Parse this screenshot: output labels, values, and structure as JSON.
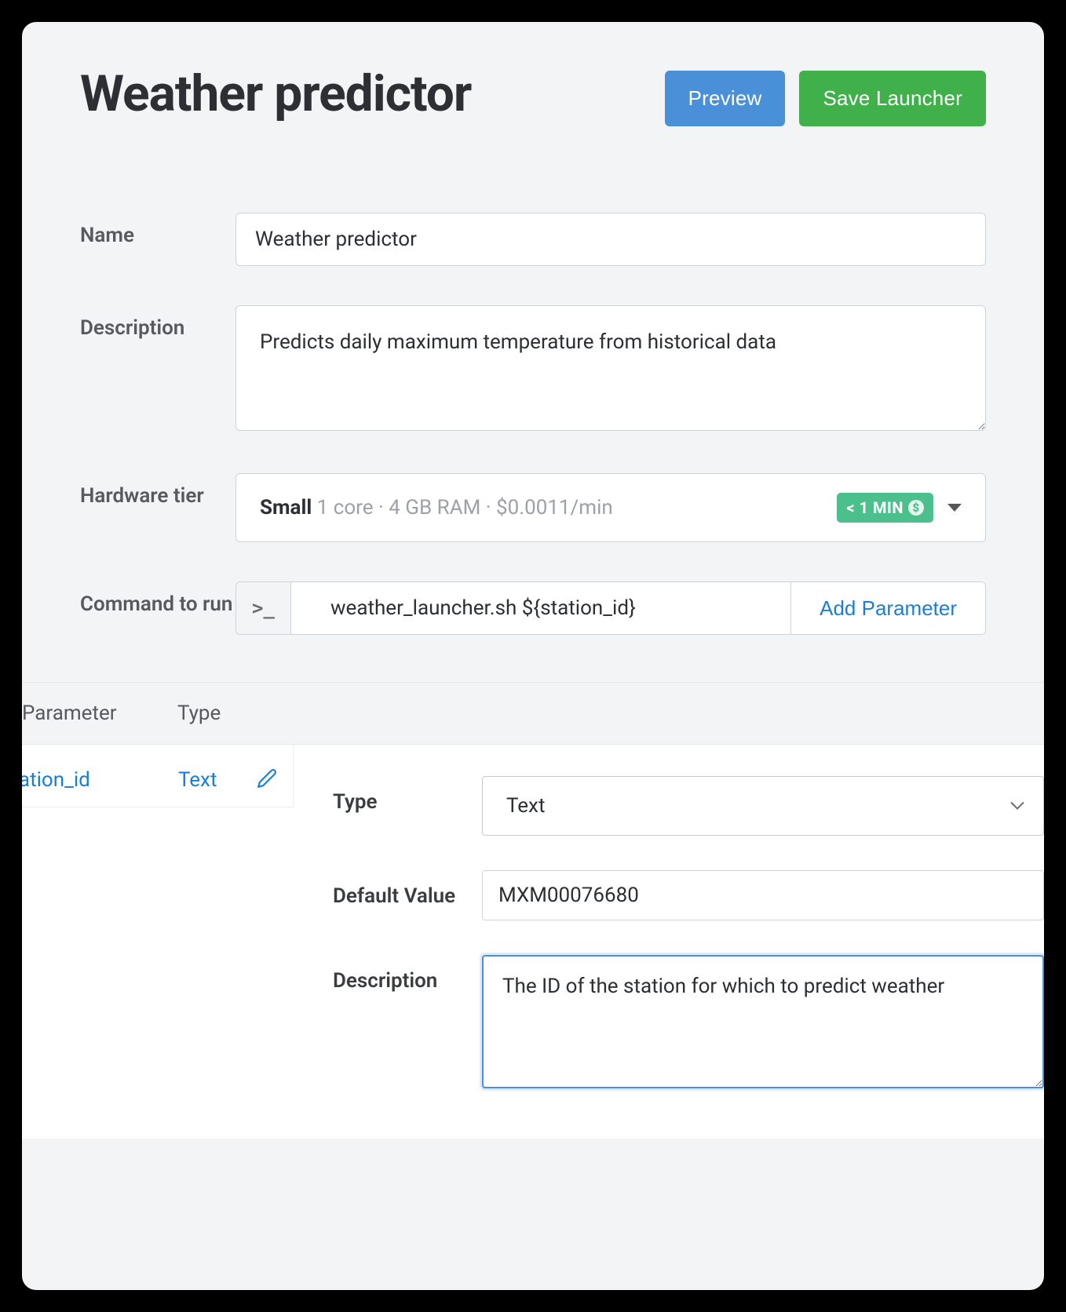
{
  "header": {
    "title": "Weather predictor",
    "preview_label": "Preview",
    "save_label": "Save Launcher"
  },
  "form": {
    "name_label": "Name",
    "name_value": "Weather predictor",
    "description_label": "Description",
    "description_value": "Predicts daily maximum temperature from historical data",
    "hardware_label": "Hardware tier",
    "hardware": {
      "name": "Small",
      "spec": "1 core · 4 GB RAM · $0.0011/min",
      "badge": "< 1 MIN"
    },
    "command_label": "Command to run",
    "command_prompt": ">_",
    "command_value": "weather_launcher.sh ${station_id}",
    "add_param_label": "Add Parameter"
  },
  "param_table": {
    "col_parameter": "Parameter",
    "col_type": "Type"
  },
  "parameter": {
    "name": "station_id",
    "type_short": "Text",
    "detail": {
      "type_label": "Type",
      "type_value": "Text",
      "default_label": "Default Value",
      "default_value": "MXM00076680",
      "description_label": "Description",
      "description_value": "The ID of the station for which to predict weather"
    }
  }
}
